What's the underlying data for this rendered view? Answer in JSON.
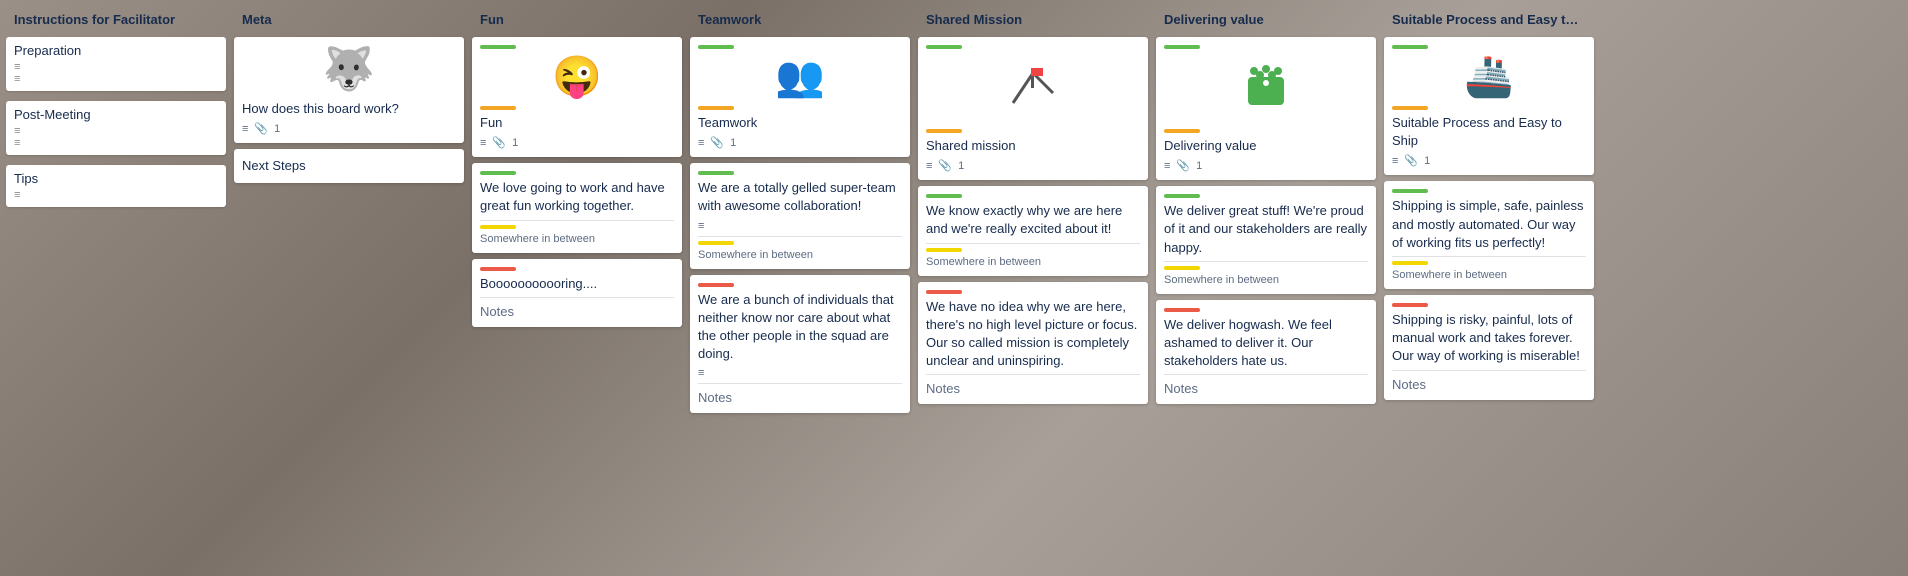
{
  "columns": [
    {
      "id": "instructions",
      "header": "Instructions for Facilitator",
      "items": [
        {
          "id": "preparation",
          "title": "Preparation",
          "lines": 2
        },
        {
          "id": "post-meeting",
          "title": "Post-Meeting",
          "lines": 2
        },
        {
          "id": "tips",
          "title": "Tips",
          "lines": 1
        }
      ]
    },
    {
      "id": "meta",
      "header": "Meta",
      "items": [
        {
          "id": "how-does-board-work",
          "emoji": "🐺",
          "text": "How does this board work?",
          "attachment_count": "1",
          "has_lines": true
        },
        {
          "id": "next-steps",
          "title": "Next Steps"
        }
      ]
    },
    {
      "id": "fun",
      "header": "Fun",
      "items": [
        {
          "id": "fun-card",
          "emoji": "😜",
          "title": "Fun",
          "top_bar": "green",
          "bottom_bar": "orange",
          "attachment_count": "1",
          "has_lines": true
        },
        {
          "id": "fun-positive",
          "top_bar": "green",
          "text": "We love going to work and have great fun working together.",
          "sub_label": "Somewhere in between"
        },
        {
          "id": "fun-negative",
          "top_bar": "red",
          "text": "Booooooooooring....",
          "notes_label": "Notes"
        }
      ]
    },
    {
      "id": "teamwork",
      "header": "Teamwork",
      "items": [
        {
          "id": "teamwork-card",
          "emoji": "👥",
          "title": "Teamwork",
          "top_bar": "green",
          "bottom_bar": "orange",
          "attachment_count": "1",
          "has_lines": true
        },
        {
          "id": "teamwork-positive",
          "top_bar": "green",
          "text": "We are a totally gelled super-team with awesome collaboration!",
          "has_lines": true,
          "sub_label": "Somewhere in between"
        },
        {
          "id": "teamwork-negative",
          "top_bar": "red",
          "text": "We are a bunch of individuals that neither know nor care about what the other people in the squad are doing.",
          "has_lines": true,
          "notes_label": "Notes"
        }
      ]
    },
    {
      "id": "shared",
      "header": "Shared Mission",
      "items": [
        {
          "id": "shared-card",
          "emoji": "🚩",
          "title": "Shared mission",
          "top_bar": "green",
          "bottom_bar": "orange",
          "attachment_count": "1",
          "has_lines": true
        },
        {
          "id": "shared-positive",
          "top_bar": "green",
          "text": "We know exactly why we are here and we're really excited about it!",
          "sub_label": "Somewhere in between"
        },
        {
          "id": "shared-negative",
          "top_bar": "red",
          "text": "We have no idea why we are here, there's no high level picture or focus. Our so called mission is completely unclear and uninspiring.",
          "notes_label": "Notes"
        }
      ]
    },
    {
      "id": "delivering",
      "header": "Delivering value",
      "items": [
        {
          "id": "delivering-card",
          "emoji": "🟢✋",
          "emoji_custom": "green_hand",
          "title": "Delivering value",
          "top_bar": "green",
          "bottom_bar": "orange",
          "attachment_count": "1",
          "has_lines": true
        },
        {
          "id": "delivering-positive",
          "top_bar": "green",
          "text": "We deliver great stuff! We're proud of it and our stakeholders are really happy.",
          "sub_label": "Somewhere in between"
        },
        {
          "id": "delivering-negative",
          "top_bar": "red",
          "text": "We deliver hogwash. We feel ashamed to deliver it. Our stakeholders hate us.",
          "notes_label": "Notes"
        }
      ]
    },
    {
      "id": "suitable",
      "header": "Suitable Process and Easy to Ship",
      "items": [
        {
          "id": "suitable-card",
          "emoji": "🚢",
          "title": "Suitable Process and Easy to Ship",
          "top_bar": "green",
          "bottom_bar": "orange",
          "attachment_count": "1",
          "has_lines": true
        },
        {
          "id": "suitable-positive",
          "top_bar": "green",
          "text": "Shipping is simple, safe, painless and mostly automated. Our way of working fits us perfectly!",
          "sub_label": "Somewhere in between"
        },
        {
          "id": "suitable-negative",
          "top_bar": "red",
          "text": "Shipping is risky, painful, lots of manual work and takes forever. Our way of working is miserable!",
          "notes_label": "Notes"
        }
      ]
    }
  ],
  "icons": {
    "lines": "≡",
    "attachment": "📎",
    "arrow": "→"
  },
  "colors": {
    "green": "#61bd4f",
    "orange": "#f2a623",
    "red": "#eb5a46",
    "yellow": "#f2d600"
  }
}
